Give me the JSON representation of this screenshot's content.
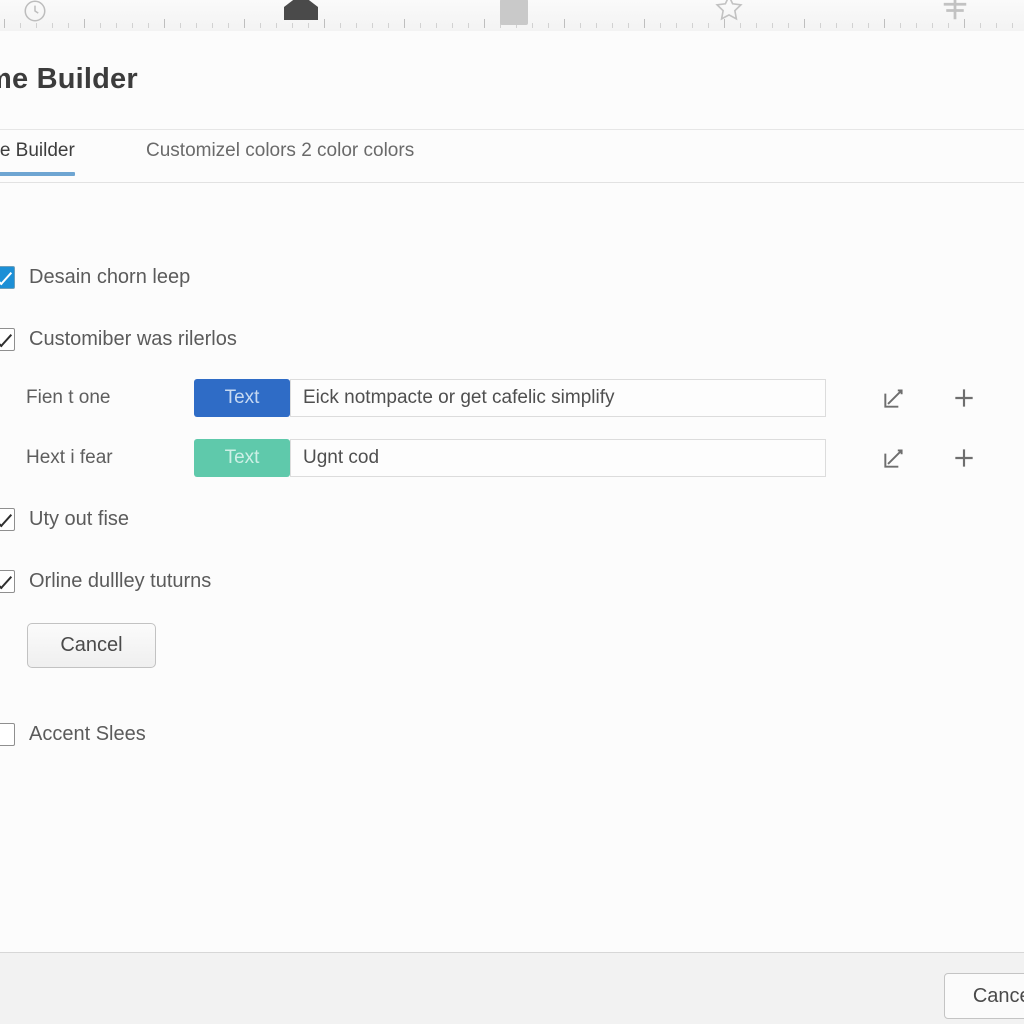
{
  "toolbar": {
    "markers": [
      {
        "name": "history-icon",
        "glyph": "ⓘ"
      },
      {
        "name": "home-marker-icon",
        "glyph": "⌂"
      },
      {
        "name": "square-marker-icon",
        "glyph": ""
      },
      {
        "name": "star-icon",
        "glyph": "☆"
      },
      {
        "name": "crosshair-icon",
        "glyph": "✚"
      }
    ]
  },
  "panel": {
    "title": "me Builder",
    "tabs": [
      {
        "label": "me Builder",
        "active": true
      },
      {
        "label": "Customizel colors 2 color colors",
        "active": false
      }
    ]
  },
  "options": {
    "top": [
      {
        "label": "Desain chorn leep",
        "checked": true,
        "style": "blue"
      },
      {
        "label": "Customiber was rilerlos",
        "checked": true,
        "style": "plain"
      }
    ],
    "bottom": [
      {
        "label": "Uty out fise",
        "checked": true,
        "style": "plain"
      },
      {
        "label": "Orline dullley tuturns",
        "checked": true,
        "style": "plain"
      }
    ],
    "accent": {
      "label": "Accent Slees",
      "checked": false,
      "style": "plain"
    }
  },
  "color_rows": [
    {
      "label": "Fien t one",
      "swatch_label": "Text",
      "swatch_color": "#2f6cc6",
      "value": "Eick notmpacte or get cafelic simplify",
      "edit_icon": "edit-box-icon",
      "add_icon": "plus-icon"
    },
    {
      "label": "Hext i fear",
      "swatch_label": "Text",
      "swatch_color": "#5fc9ab",
      "value": "Ugnt cod",
      "edit_icon": "edit-box-icon",
      "add_icon": "plus-icon"
    }
  ],
  "buttons": {
    "inline_cancel": "Cancel",
    "footer_cancel": "Cancel"
  },
  "colors": {
    "accent_tab_underline": "#6ea5d2",
    "checkbox_checked": "#1c8fd6",
    "swatch_blue": "#2f6cc6",
    "swatch_green": "#5fc9ab"
  }
}
